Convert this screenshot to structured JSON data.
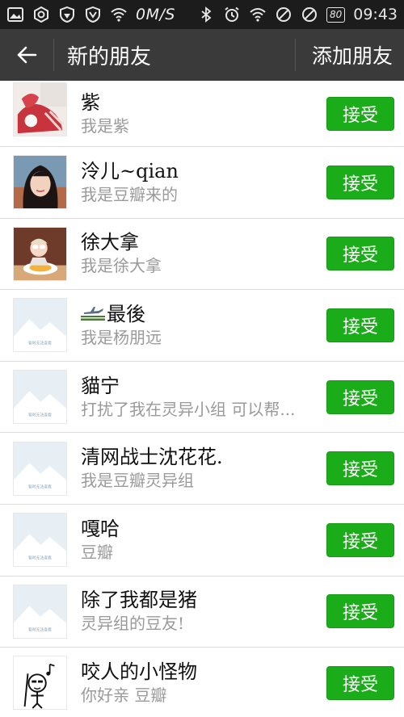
{
  "status_bar": {
    "speed": "0M/S",
    "battery": "80",
    "time": "09:43"
  },
  "header": {
    "title": "新的朋友",
    "action": "添加朋友"
  },
  "requests": [
    {
      "name": "紫",
      "message": "我是紫",
      "avatar": "photo-red-item",
      "button": "接受"
    },
    {
      "name": "泠儿~qian",
      "message": "我是豆瓣来的",
      "avatar": "photo-woman",
      "button": "接受"
    },
    {
      "name": "徐大拿",
      "message": "我是徐大拿",
      "avatar": "photo-child-food",
      "button": "接受"
    },
    {
      "name": "最後",
      "message": "我是杨朋远",
      "avatar": "placeholder-image",
      "button": "接受"
    },
    {
      "name": "貓宁",
      "message": "打扰了我在灵异小组 可以帮...",
      "avatar": "placeholder-image",
      "button": "接受"
    },
    {
      "name": "清网战士沈花花.",
      "message": "我是豆瓣灵异组",
      "avatar": "placeholder-image",
      "button": "接受"
    },
    {
      "name": "嘎哈",
      "message": "豆瓣",
      "avatar": "placeholder-image",
      "button": "接受"
    },
    {
      "name": "除了我都是猪",
      "message": "灵异组的豆友!",
      "avatar": "placeholder-image",
      "button": "接受"
    },
    {
      "name": "咬人的小怪物",
      "message": "你好亲 豆瓣",
      "avatar": "drawing-stickman",
      "button": "接受"
    }
  ],
  "placeholder_caption": "暂时无法查看",
  "colors": {
    "accept_green": "#1aad19",
    "title_bar": "#3a3a3a",
    "status_bar": "#1c1c1c"
  }
}
